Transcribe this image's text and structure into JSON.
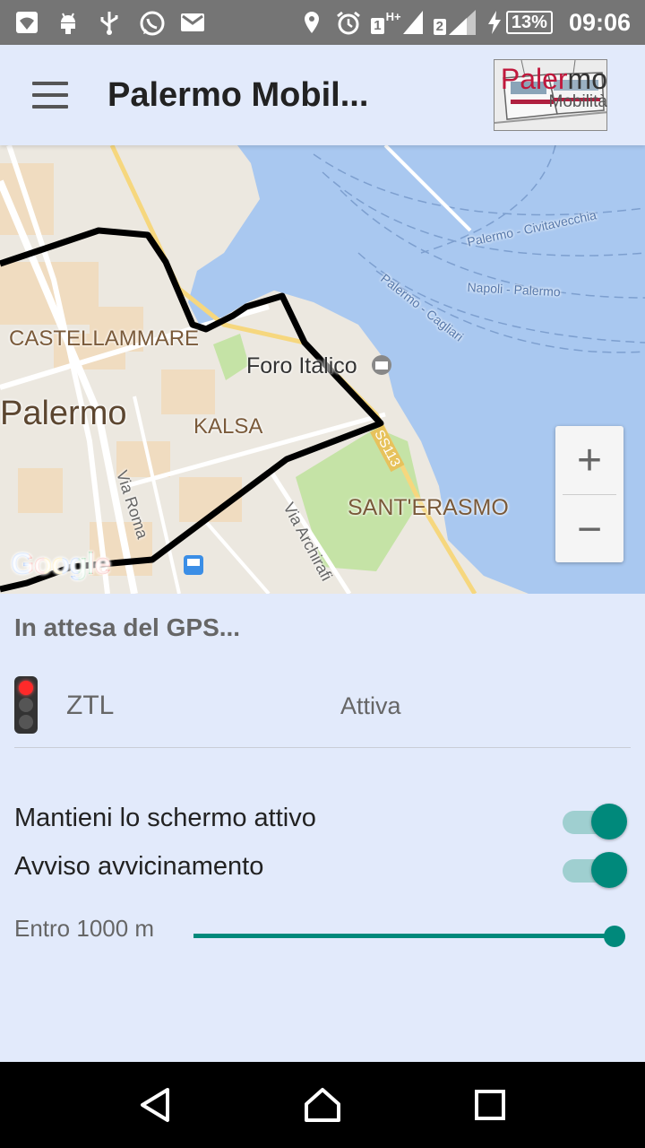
{
  "status_bar": {
    "battery": "13%",
    "time": "09:06",
    "network_1": "1",
    "network_type": "H+",
    "network_2": "2",
    "icons": [
      "wifi-icon",
      "android-icon",
      "usb-icon",
      "whatsapp-icon",
      "mail-icon",
      "location-icon",
      "alarm-icon",
      "signal-icon",
      "charging-icon",
      "battery-icon"
    ]
  },
  "app_bar": {
    "title": "Palermo Mobil...",
    "logo_brand_a": "Paler",
    "logo_brand_b": "mo",
    "logo_sub": "Mobilità"
  },
  "map": {
    "labels": {
      "castellammare": "CASTELLAMMARE",
      "palermo": "Palermo",
      "kalsa": "KALSA",
      "foro_italico": "Foro Italico",
      "santerasmo": "SANT'ERASMO",
      "via_roma": "Via Roma",
      "via_archirafi": "Via Archirafi",
      "civitavecchia": "Palermo - Civitavecchia",
      "napoli": "Napoli - Palermo",
      "cagliari": "Palermo - Cagliari",
      "ss113": "SS113"
    },
    "zoom_in": "+",
    "zoom_out": "−",
    "attribution": "Google"
  },
  "gps_status": "In attesa del GPS...",
  "ztl": {
    "label": "ZTL",
    "status": "Attiva"
  },
  "settings": {
    "keep_screen": {
      "label": "Mantieni lo schermo attivo",
      "enabled": true
    },
    "proximity": {
      "label": "Avviso avvicinamento",
      "enabled": true
    }
  },
  "range": {
    "label": "Entro 1000 m",
    "fraction": 1.0
  },
  "colors": {
    "accent": "#00897b",
    "background": "#e2eafb",
    "status_bar": "#757575",
    "water": "#a9c8f0"
  }
}
